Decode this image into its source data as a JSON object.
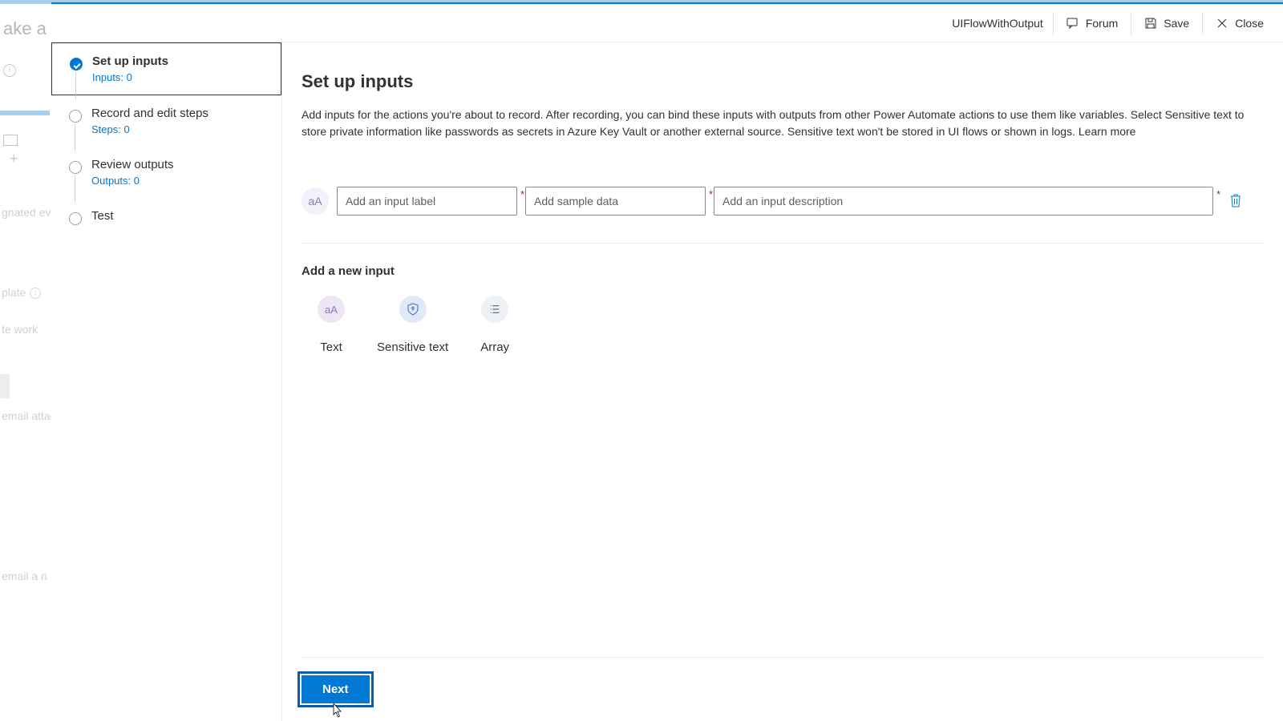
{
  "background": {
    "title_fragment": "ake a fl",
    "line1": "gnated even",
    "line2": "plate",
    "line3": "te work",
    "line4": "email attac",
    "line5": "email a n"
  },
  "header": {
    "flow_name": "UIFlowWithOutput",
    "forum": "Forum",
    "save": "Save",
    "close": "Close"
  },
  "steps": [
    {
      "title": "Set up inputs",
      "sub": "Inputs: 0"
    },
    {
      "title": "Record and edit steps",
      "sub": "Steps: 0"
    },
    {
      "title": "Review outputs",
      "sub": "Outputs: 0"
    },
    {
      "title": "Test",
      "sub": ""
    }
  ],
  "content": {
    "title": "Set up inputs",
    "description": "Add inputs for the actions you're about to record. After recording, you can bind these inputs with outputs from other Power Automate actions to use them like variables. Select Sensitive text to store private information like passwords as secrets in Azure Key Vault or another external source. Sensitive text won't be stored in UI flows or shown in logs.",
    "learn_more": "Learn more",
    "input_label_placeholder": "Add an input label",
    "sample_placeholder": "Add sample data",
    "description_placeholder": "Add an input description",
    "add_new_title": "Add a new input",
    "types": {
      "text": "Text",
      "sensitive": "Sensitive text",
      "array": "Array"
    },
    "next": "Next"
  }
}
